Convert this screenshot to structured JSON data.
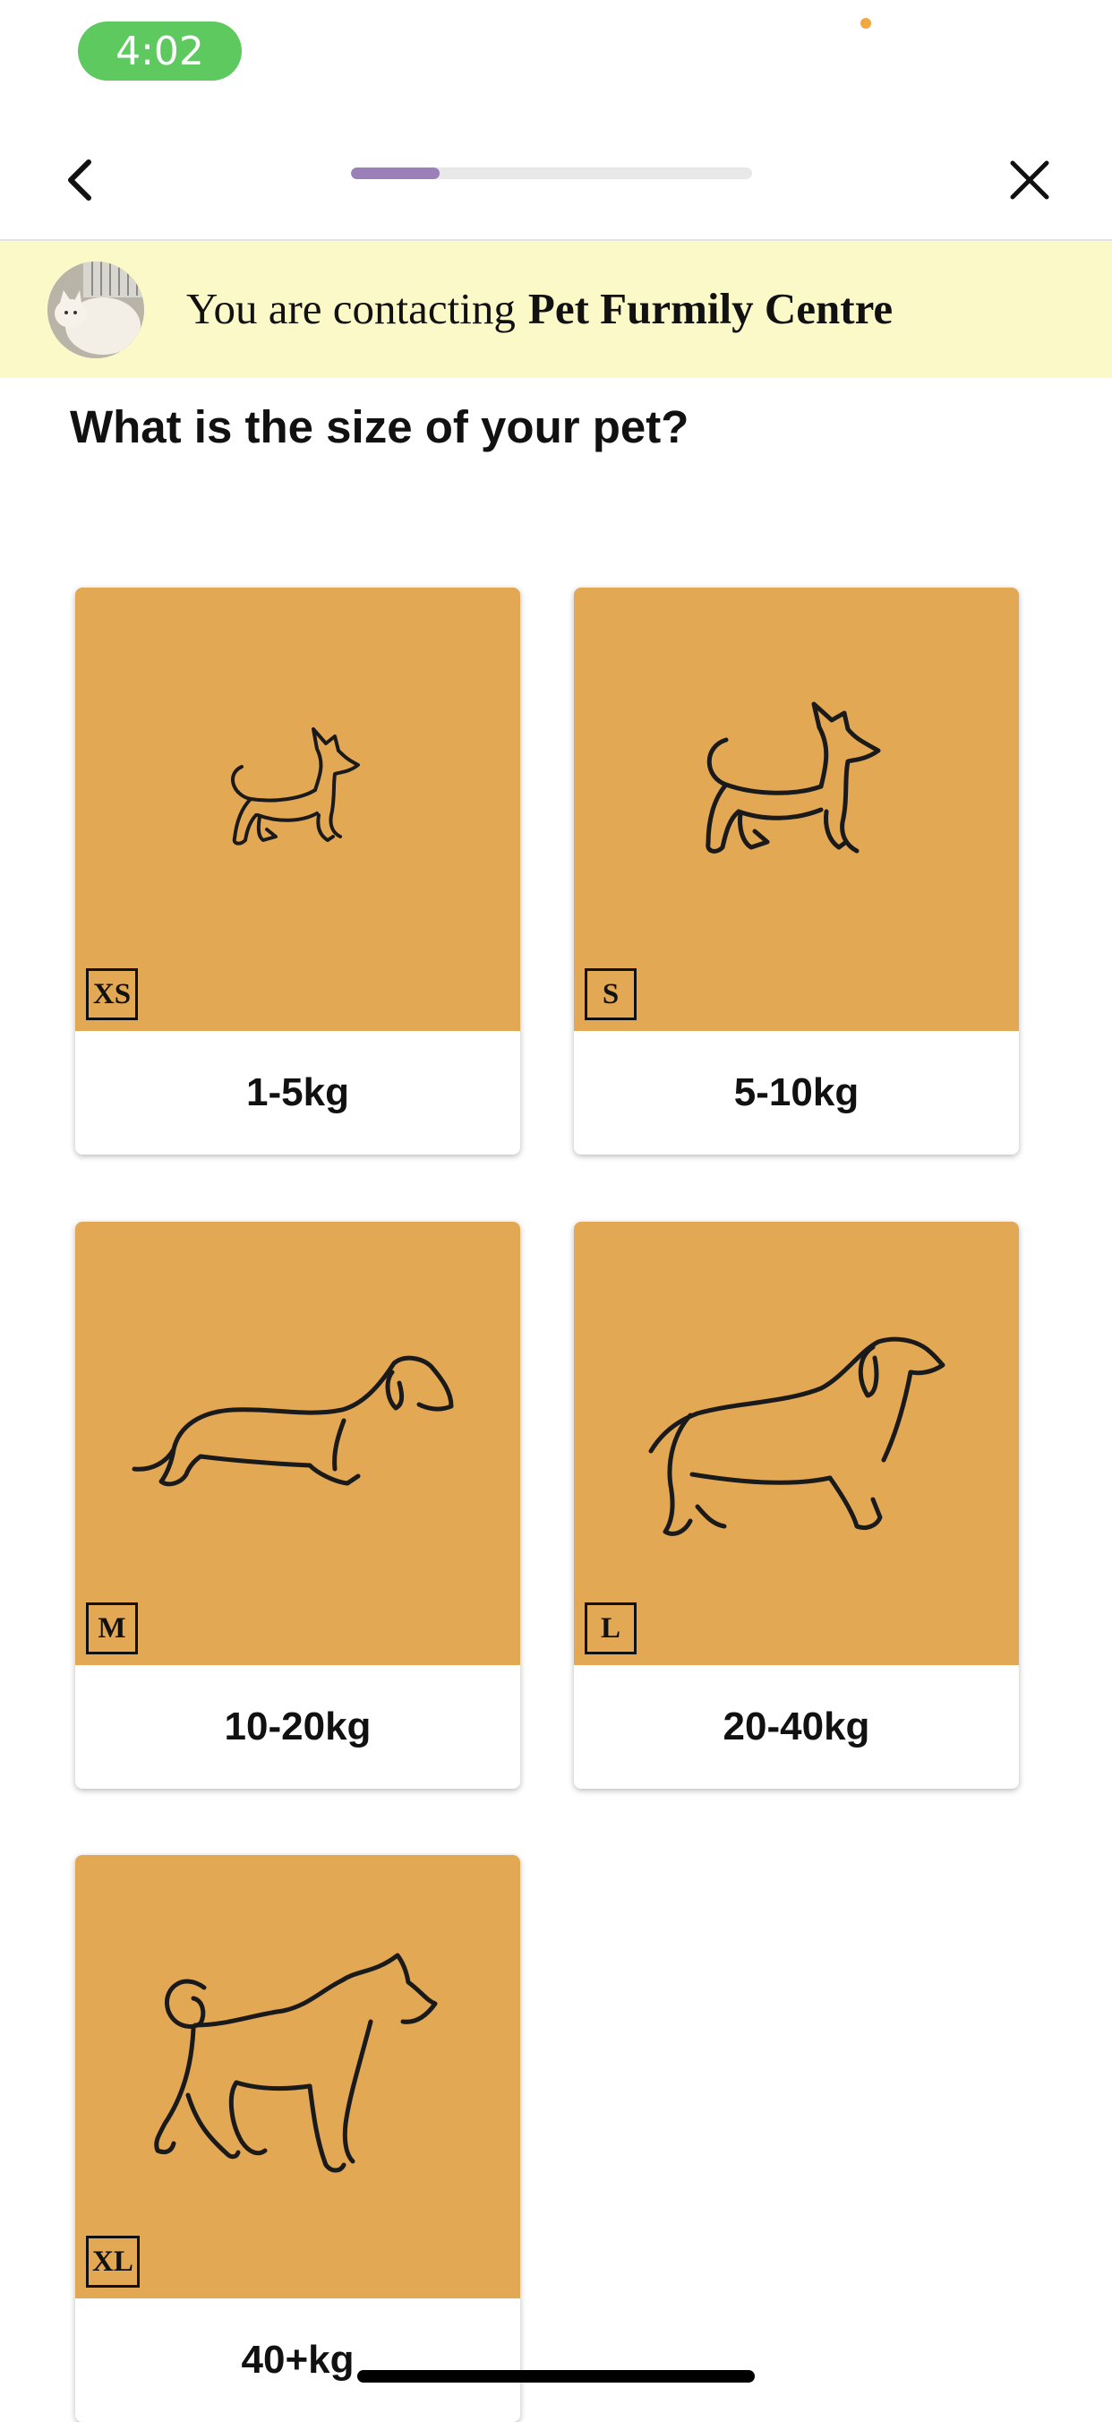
{
  "status_bar": {
    "time": "4:02"
  },
  "nav": {
    "back_icon": "chevron-left-icon",
    "close_icon": "close-icon",
    "progress": 0.22,
    "progress_color": "#9a7fb8"
  },
  "banner": {
    "prefix": "You are contacting",
    "business_name": "Pet Furmily Centre",
    "background": "#fcf9c8"
  },
  "question": "What is the size of your pet?",
  "card_color": "#e3a853",
  "options": [
    {
      "size": "XS",
      "weight": "1-5kg",
      "icon": "chihuahua-icon"
    },
    {
      "size": "S",
      "weight": "5-10kg",
      "icon": "small-dog-icon"
    },
    {
      "size": "M",
      "weight": "10-20kg",
      "icon": "dachshund-icon"
    },
    {
      "size": "L",
      "weight": "20-40kg",
      "icon": "spaniel-icon"
    },
    {
      "size": "XL",
      "weight": "40+kg",
      "icon": "husky-icon"
    }
  ]
}
